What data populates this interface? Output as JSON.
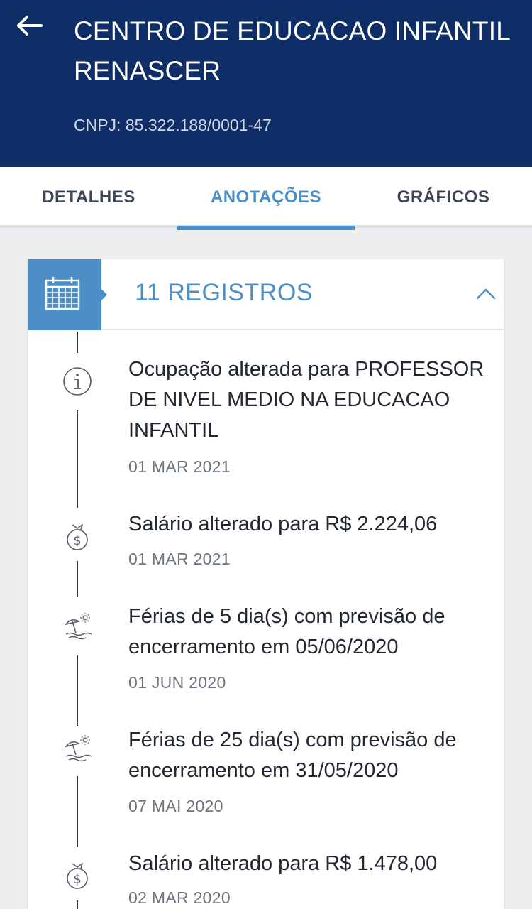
{
  "header": {
    "company_name": "CENTRO DE EDUCACAO INFANTIL RENASCER",
    "cnpj": "CNPJ: 85.322.188/0001-47",
    "back_icon": "arrow-left-icon"
  },
  "tabs": [
    {
      "label": "DETALHES",
      "active": false
    },
    {
      "label": "ANOTAÇÕES",
      "active": true
    },
    {
      "label": "GRÁFICOS",
      "active": false
    }
  ],
  "card": {
    "title": "11 REGISTROS",
    "header_icon": "calendar-icon",
    "toggle_icon": "chevron-up-icon"
  },
  "entries": [
    {
      "icon": "info-icon",
      "text": "Ocupação alterada para PROFESSOR DE NIVEL MEDIO NA EDUCACAO INFANTIL",
      "date": "01 MAR 2021"
    },
    {
      "icon": "money-bag-icon",
      "text": "Salário alterado para R$ 2.224,06",
      "date": "01 MAR 2021"
    },
    {
      "icon": "beach-umbrella-icon",
      "text": "Férias de 5 dia(s) com previsão de encerramento em 05/06/2020",
      "date": "01 JUN 2020"
    },
    {
      "icon": "beach-umbrella-icon",
      "text": "Férias de 25 dia(s) com previsão de encerramento em 31/05/2020",
      "date": "07 MAI 2020"
    },
    {
      "icon": "money-bag-icon",
      "text": "Salário alterado para R$ 1.478,00",
      "date": "02 MAR 2020"
    }
  ],
  "colors": {
    "header_bg": "#0f2d66",
    "accent": "#4b8fc6",
    "text": "#222831",
    "date": "#6b7580"
  }
}
